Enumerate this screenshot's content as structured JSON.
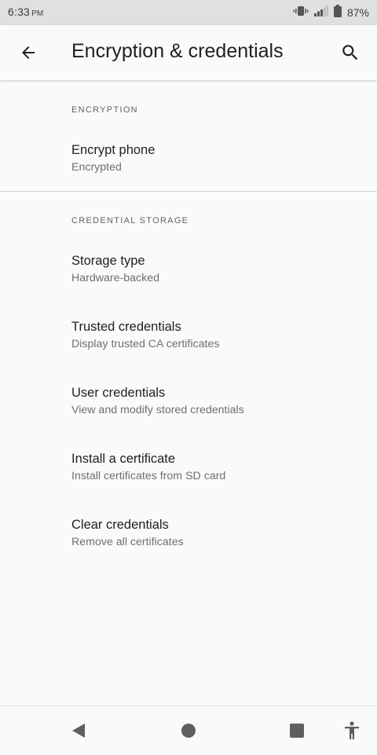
{
  "status_bar": {
    "time": "6:33",
    "ampm": "PM",
    "battery_percent": "87%",
    "icons": [
      "vibrate-icon",
      "signal-icon",
      "battery-icon"
    ]
  },
  "app_bar": {
    "title": "Encryption & credentials",
    "icons": [
      "back-arrow-icon",
      "search-icon"
    ]
  },
  "sections": [
    {
      "header": "ENCRYPTION",
      "items": [
        {
          "title": "Encrypt phone",
          "summary": "Encrypted"
        }
      ]
    },
    {
      "header": "CREDENTIAL STORAGE",
      "items": [
        {
          "title": "Storage type",
          "summary": "Hardware-backed"
        },
        {
          "title": "Trusted credentials",
          "summary": "Display trusted CA certificates"
        },
        {
          "title": "User credentials",
          "summary": "View and modify stored credentials"
        },
        {
          "title": "Install a certificate",
          "summary": "Install certificates from SD card"
        },
        {
          "title": "Clear credentials",
          "summary": "Remove all certificates"
        }
      ]
    }
  ],
  "nav_bar": {
    "icons": [
      "back-triangle-icon",
      "home-circle-icon",
      "recents-square-icon",
      "accessibility-icon"
    ]
  },
  "colors": {
    "background": "#fafafa",
    "status_bar": "#e0e0e0",
    "primary_text": "#202124",
    "secondary_text": "#6f6f6f",
    "nav_icons": "#5f5f5f"
  }
}
